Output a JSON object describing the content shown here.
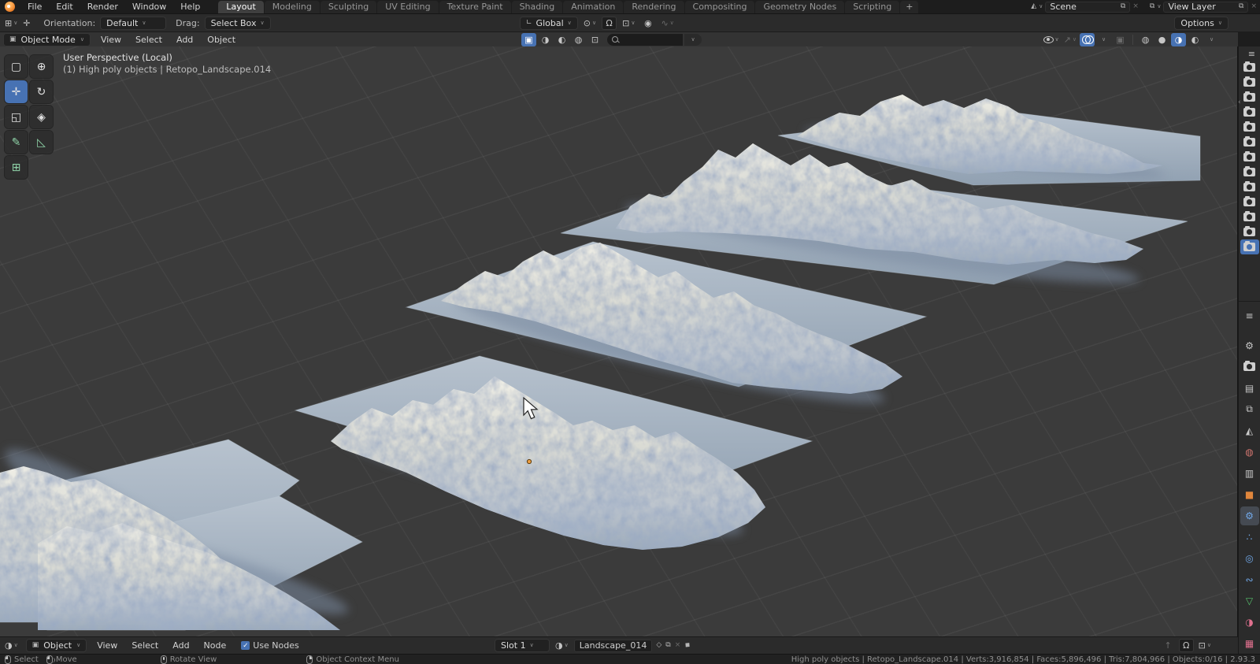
{
  "ui": {
    "chevron": "∨",
    "check": "✓",
    "close": "×",
    "copy": "⧉",
    "collapse_arrow": "‹",
    "up_arrow": "↑",
    "magnet": "Ω",
    "snap_grid": "⊡",
    "pivot": "⊙",
    "axis": "∟",
    "prop_circle": "◉",
    "falloff": "∿",
    "editor_grid": "⊞",
    "move_cross": "✛",
    "mode_square": "▣",
    "xray": "▣",
    "gizmo_arrow": "↗",
    "shade_wire": "◍",
    "shade_solid": "●",
    "shade_material": "◑",
    "shade_rendered": "◐",
    "scene_icon": "◭",
    "viewlayer_icon": "⧉",
    "outliner_icon": "≡",
    "shaderball": "◑",
    "shield": "◇",
    "pin": "◆"
  },
  "topbar": {
    "menus": [
      "File",
      "Edit",
      "Render",
      "Window",
      "Help"
    ],
    "tabs": [
      {
        "label": "Layout",
        "active": true
      },
      {
        "label": "Modeling"
      },
      {
        "label": "Sculpting"
      },
      {
        "label": "UV Editing"
      },
      {
        "label": "Texture Paint"
      },
      {
        "label": "Shading"
      },
      {
        "label": "Animation"
      },
      {
        "label": "Rendering"
      },
      {
        "label": "Compositing"
      },
      {
        "label": "Geometry Nodes"
      },
      {
        "label": "Scripting"
      }
    ],
    "new_tab_label": "+",
    "scene_value": "Scene",
    "view_layer_value": "View Layer"
  },
  "tool_settings": {
    "orientation_label": "Orientation:",
    "orientation_value": "Default",
    "drag_label": "Drag:",
    "drag_value": "Select Box",
    "transform_orientation": "Global",
    "options_label": "Options"
  },
  "viewport_header": {
    "mode_label": "Object Mode",
    "menus": [
      "View",
      "Select",
      "Add",
      "Object"
    ]
  },
  "viewport": {
    "overlay_line1": "User Perspective (Local)",
    "overlay_line2": "(1) High poly objects | Retopo_Landscape.014"
  },
  "toolbar": {
    "tools": [
      {
        "name": "select-box",
        "glyph": "▢"
      },
      {
        "name": "cursor",
        "glyph": "⊕"
      },
      {
        "name": "move",
        "glyph": "✛",
        "active": true
      },
      {
        "name": "rotate",
        "glyph": "↻"
      },
      {
        "name": "scale",
        "glyph": "◱"
      },
      {
        "name": "transform",
        "glyph": "◈"
      },
      {
        "name": "annotate",
        "glyph": "✎",
        "tint": true
      },
      {
        "name": "measure",
        "glyph": "◺",
        "tint": true
      },
      {
        "name": "add-cube",
        "glyph": "⊞",
        "tint": true
      }
    ]
  },
  "outliner": {
    "camera_rows": 13,
    "selected_row": 12
  },
  "properties": {
    "tabs": [
      {
        "name": "tool",
        "glyph": "⚙",
        "color": "#c9c9c9"
      },
      {
        "name": "render",
        "glyph": "CAM",
        "color": "#c9c9c9"
      },
      {
        "name": "output",
        "glyph": "▤",
        "color": "#c9c9c9"
      },
      {
        "name": "view-layer",
        "glyph": "⧉",
        "color": "#c9c9c9"
      },
      {
        "name": "scene",
        "glyph": "◭",
        "color": "#c9c9c9"
      },
      {
        "name": "world",
        "glyph": "◍",
        "color": "#d0756f"
      },
      {
        "name": "collection",
        "glyph": "▥",
        "color": "#c9c9c9"
      },
      {
        "name": "object",
        "glyph": "■",
        "color": "#e0863c"
      },
      {
        "name": "modifiers",
        "glyph": "⚙",
        "color": "#71a8e8",
        "active": true
      },
      {
        "name": "particles",
        "glyph": "∴",
        "color": "#71a8e8"
      },
      {
        "name": "physics",
        "glyph": "◎",
        "color": "#71a8e8"
      },
      {
        "name": "constraints",
        "glyph": "∾",
        "color": "#71a8e8"
      },
      {
        "name": "object-data",
        "glyph": "▽",
        "color": "#56c06c"
      },
      {
        "name": "material",
        "glyph": "◑",
        "color": "#e0708e"
      },
      {
        "name": "texture",
        "glyph": "▦",
        "color": "#e0708e"
      }
    ]
  },
  "node_editor": {
    "shader_type_value": "Object",
    "menus": [
      "View",
      "Select",
      "Add",
      "Node"
    ],
    "use_nodes_label": "Use Nodes",
    "use_nodes_checked": true,
    "slot_value": "Slot 1",
    "material_name": "Landscape_014"
  },
  "status_bar": {
    "hints": [
      {
        "button": "left",
        "label": "Select"
      },
      {
        "button": "drag",
        "label": "Move"
      },
      {
        "button": "middle",
        "label": "Rotate View"
      },
      {
        "button": "right",
        "label": "Object Context Menu"
      }
    ],
    "stats": "High poly objects | Retopo_Landscape.014 | Verts:3,916,854 | Faces:5,896,496 | Tris:7,804,966 | Objects:0/16 | 2.93.3"
  },
  "colors": {
    "accent": "#4772b3",
    "viewport_bg": "#3b3b3b",
    "plane_top": "#b7c2ce",
    "plane_bottom": "#90a0b1",
    "mountain_light": "#efeee6",
    "mountain_shadow": "#9dabbb",
    "origin_dot": "#ed9e40"
  }
}
